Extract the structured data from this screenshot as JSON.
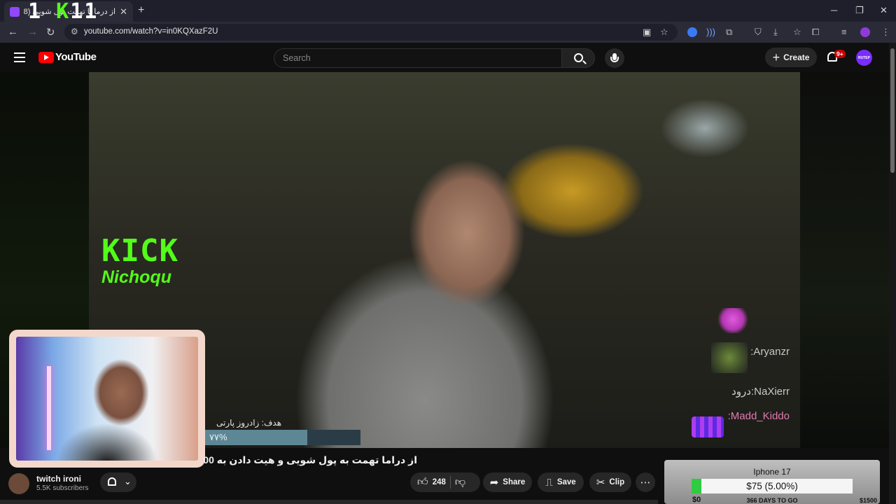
{
  "browser": {
    "tab_title": "از درما تا تهمت پول شویی (8)",
    "overlay_prefix": "1",
    "overlay_k": "K",
    "overlay_suffix": "11",
    "url": "youtube.com/watch?v=in0KQXazF2U"
  },
  "youtube": {
    "logo_text": "YouTube",
    "search_placeholder": "Search",
    "create_label": "Create",
    "notifications_badge": "9+",
    "avatar_text": "RUTEP"
  },
  "video": {
    "kick_logo": "KICK",
    "kick_name": "Nichoqu",
    "chat": [
      {
        "user": ":Aryanzr",
        "msg": ""
      },
      {
        "user": ":NaXierr",
        "msg": "درود"
      },
      {
        "user": ":Madd_Kiddo",
        "msg": ""
      }
    ],
    "goal_label": "هدف: زادروز پارتی",
    "goal_percent_text": "۷۷%",
    "goal_progress": 0.66
  },
  "info": {
    "title": "از دراما تهمت به پول شویی و هیت دادن به 600 میلیون دو",
    "channel_name": "twitch ironi",
    "subscribers": "5.5K subscribers",
    "likes": "248",
    "share_label": "Share",
    "save_label": "Save",
    "clip_label": "Clip"
  },
  "donation": {
    "title": "Iphone 17",
    "amount": "$75 (5.00%)",
    "progress": 0.05,
    "min": "$0",
    "days": "366 DAYS TO GO",
    "max": "$1500"
  },
  "colors": {
    "kick_green": "#53fc18",
    "youtube_red": "#ff0000",
    "twitch_purple": "#9147ff"
  }
}
